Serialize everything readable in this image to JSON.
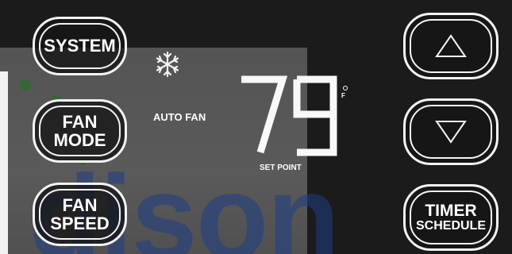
{
  "buttons": {
    "system": "SYSTEM",
    "fan_mode": [
      "FAN",
      "MODE"
    ],
    "fan_speed": [
      "FAN",
      "SPEED"
    ],
    "timer": "TIMER",
    "schedule": "SCHEDULE"
  },
  "display": {
    "mode_label": "AUTO FAN",
    "temperature": "79",
    "unit": "F",
    "set_point_label": "SET POINT",
    "mode_icon": "snowflake-icon"
  },
  "watermark_text": "dison",
  "colors": {
    "background": "#1b1b1b",
    "button_border": "#f4f4f4",
    "watermark": "#1f3f86"
  }
}
